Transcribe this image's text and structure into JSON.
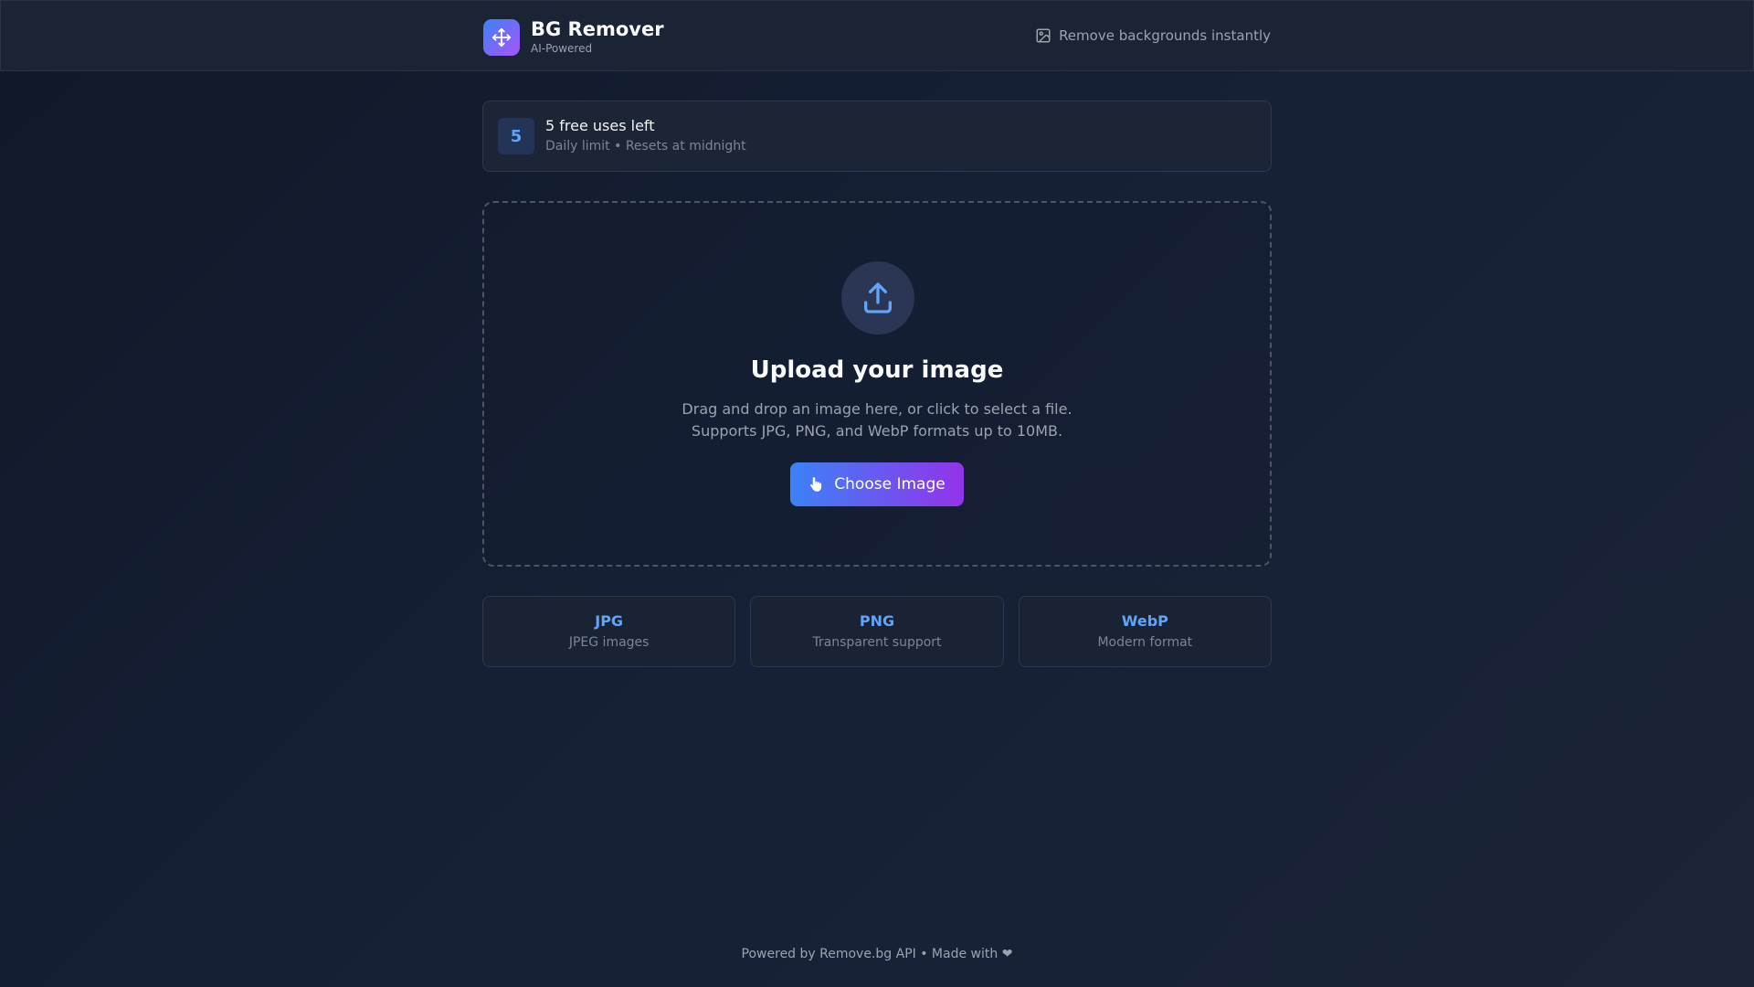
{
  "header": {
    "title": "BG Remover",
    "subtitle": "AI-Powered",
    "tagline": "Remove backgrounds instantly",
    "logo_icon": "move-icon",
    "tagline_icon": "image-icon"
  },
  "usage": {
    "count": "5",
    "title": "5 free uses left",
    "subtitle": "Daily limit • Resets at midnight"
  },
  "upload": {
    "icon": "upload-icon",
    "title": "Upload your image",
    "description_line1": "Drag and drop an image here, or click to select a file.",
    "description_line2": "Supports JPG, PNG, and WebP formats up to 10MB.",
    "button_label": "Choose Image",
    "button_icon": "pointer-hand-icon"
  },
  "formats": [
    {
      "name": "JPG",
      "description": "JPEG images"
    },
    {
      "name": "PNG",
      "description": "Transparent support"
    },
    {
      "name": "WebP",
      "description": "Modern format"
    }
  ],
  "footer": {
    "text": "Powered by Remove.bg API • Made with ❤"
  },
  "colors": {
    "accent_blue": "#3b82f6",
    "accent_purple": "#9333ea",
    "format_label": "#60a5fa",
    "background": "#111827"
  }
}
